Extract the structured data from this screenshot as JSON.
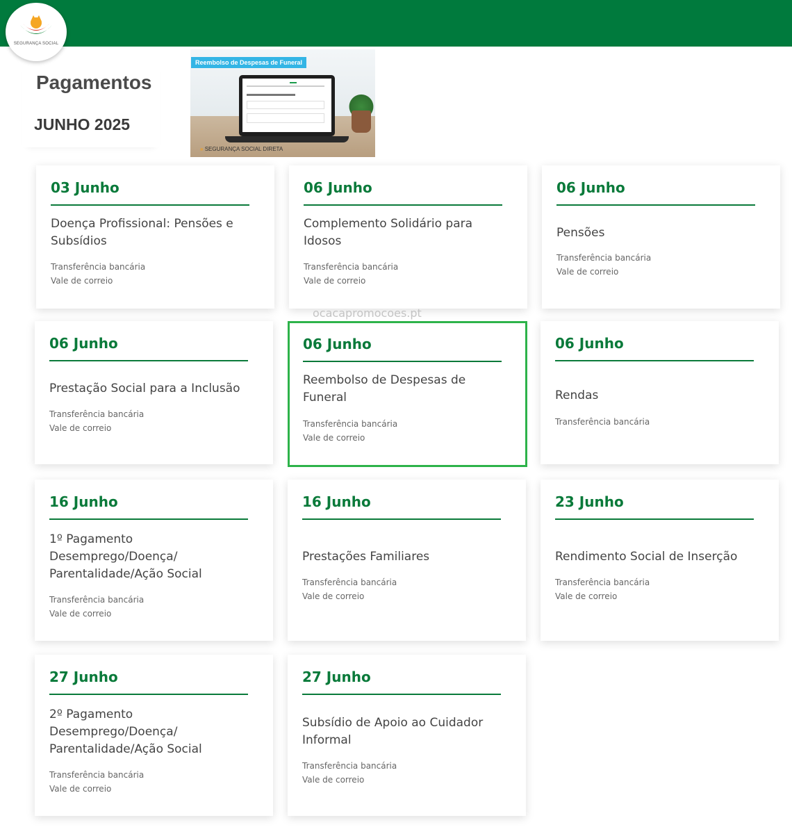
{
  "brand": {
    "logo_text": "SEGURANÇA SOCIAL"
  },
  "header": {
    "title": "Pagamentos",
    "subtitle": "JUNHO 2025"
  },
  "banner": {
    "title": "Reembolso de Despesas de Funeral",
    "brand_text": "SEGURANÇA SOCIAL DIRETA"
  },
  "watermark": "ocacapromocoes.pt",
  "colors": {
    "brand_green": "#007a3d",
    "date_green": "#0a7a3a",
    "selected_border": "#2db34a"
  },
  "cards": [
    {
      "date": "03 Junho",
      "title": "Doença Profissional: Pensões e Subsídios",
      "methods": [
        "Transferência bancária",
        "Vale de correio"
      ]
    },
    {
      "date": "06 Junho",
      "title": "Complemento Solidário para Idosos",
      "methods": [
        "Transferência bancária",
        "Vale de correio"
      ]
    },
    {
      "date": "06 Junho",
      "title": "Pensões",
      "methods": [
        "Transferência bancária",
        "Vale de correio"
      ]
    },
    {
      "date": "06 Junho",
      "title": "Prestação Social para a Inclusão",
      "methods": [
        "Transferência bancária",
        "Vale de correio"
      ]
    },
    {
      "date": "06 Junho",
      "title": "Reembolso de Despesas de Funeral",
      "methods": [
        "Transferência bancária",
        "Vale de correio"
      ],
      "selected": true
    },
    {
      "date": "06 Junho",
      "title": "Rendas",
      "methods": [
        "Transferência bancária"
      ]
    },
    {
      "date": "16 Junho",
      "title": "1º Pagamento Desemprego/Doença/ Parentalidade/Ação Social",
      "methods": [
        "Transferência bancária",
        "Vale de correio"
      ]
    },
    {
      "date": "16 Junho",
      "title": "Prestações Familiares",
      "methods": [
        "Transferência bancária",
        "Vale de correio"
      ]
    },
    {
      "date": "23 Junho",
      "title": "Rendimento Social de Inserção",
      "methods": [
        "Transferência bancária",
        "Vale de correio"
      ]
    },
    {
      "date": "27 Junho",
      "title": "2º Pagamento Desemprego/Doença/ Parentalidade/Ação Social",
      "methods": [
        "Transferência bancária",
        "Vale de correio"
      ]
    },
    {
      "date": "27 Junho",
      "title": "Subsídio de Apoio ao Cuidador Informal",
      "methods": [
        "Transferência bancária",
        "Vale de correio"
      ]
    }
  ]
}
